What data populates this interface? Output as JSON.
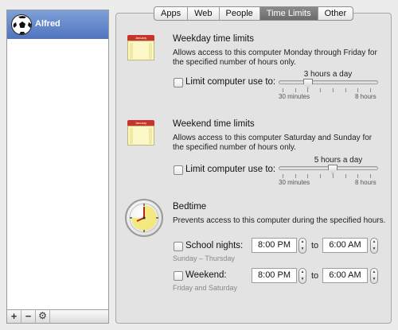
{
  "sidebar": {
    "user_name": "Alfred",
    "bottom_buttons": [
      "+",
      "−",
      "⚙"
    ]
  },
  "tabs": [
    {
      "label": "Apps",
      "active": false
    },
    {
      "label": "Web",
      "active": false
    },
    {
      "label": "People",
      "active": false
    },
    {
      "label": "Time Limits",
      "active": true
    },
    {
      "label": "Other",
      "active": false
    }
  ],
  "weekday": {
    "calendar_month": "January",
    "title": "Weekday time limits",
    "description": "Allows access to this computer Monday through Friday for the specified number of hours only.",
    "checkbox_label": "Limit computer use to:",
    "checked": false,
    "value_label": "3 hours a day",
    "min_label": "30 minutes",
    "max_label": "8 hours",
    "value_fraction": 0.29
  },
  "weekend": {
    "calendar_month": "January",
    "title": "Weekend time limits",
    "description": "Allows access to this computer Saturday and Sunday for the specified number of hours only.",
    "checkbox_label": "Limit computer use to:",
    "checked": false,
    "value_label": "5 hours a day",
    "min_label": "30 minutes",
    "max_label": "8 hours",
    "value_fraction": 0.57
  },
  "bedtime": {
    "title": "Bedtime",
    "description": "Prevents access to this computer during the specified hours.",
    "to_label": "to",
    "school_nights": {
      "label": "School nights:",
      "days": "Sunday – Thursday",
      "start": "8:00 PM",
      "end": "6:00 AM",
      "checked": false
    },
    "weekend": {
      "label": "Weekend:",
      "days": "Friday and Saturday",
      "start": "8:00 PM",
      "end": "6:00 AM",
      "checked": false
    }
  },
  "colors": {
    "selection": "#5b7fc7",
    "active_tab": "#757575",
    "calendar_header": "#c8342b",
    "calendar_body": "#fbf7c6"
  }
}
